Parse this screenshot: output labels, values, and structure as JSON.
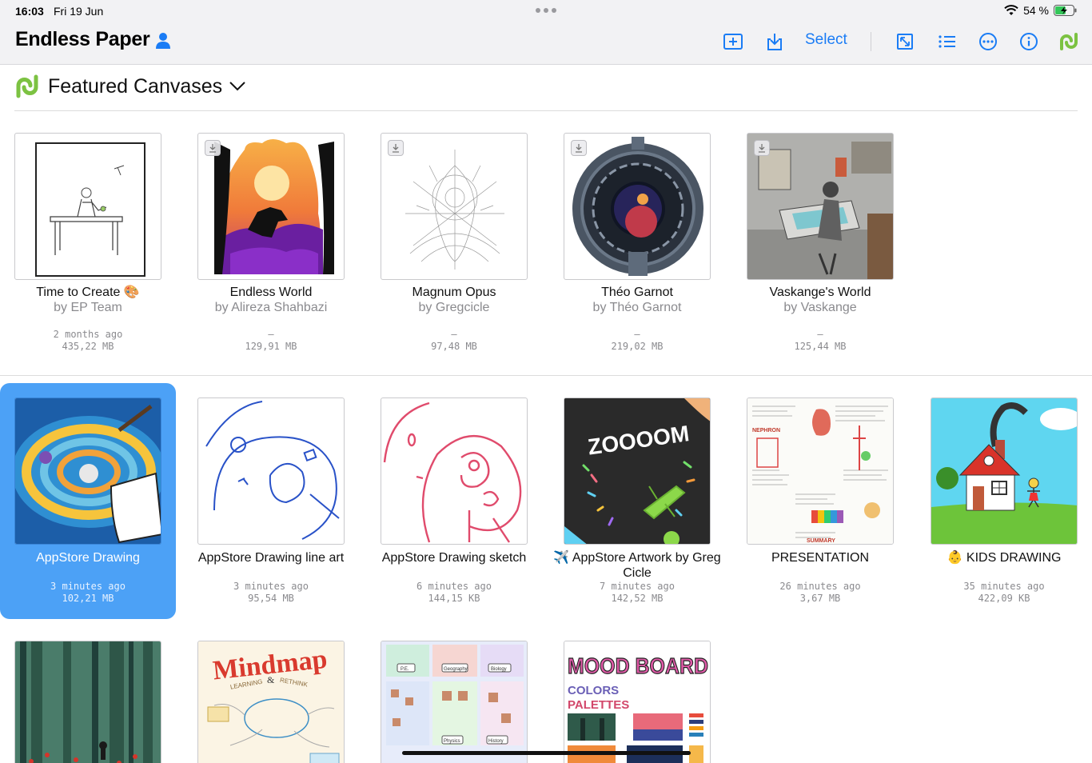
{
  "status_bar": {
    "time": "16:03",
    "date": "Fri 19 Jun",
    "battery": "54 %"
  },
  "nav": {
    "title": "Endless Paper",
    "select_label": "Select",
    "icons": [
      "add-canvas-icon",
      "import-icon",
      "fullscreen-icon",
      "list-icon",
      "more-icon",
      "info-icon",
      "link-icon"
    ]
  },
  "section": {
    "title": "Featured Canvases"
  },
  "featured": [
    {
      "title": "Time to Create 🎨",
      "author": "by EP Team",
      "modified": "2 months ago",
      "size": "435,22 MB"
    },
    {
      "title": "Endless World",
      "author": "by Alireza Shahbazi",
      "modified": "–",
      "size": "129,91 MB"
    },
    {
      "title": "Magnum Opus",
      "author": "by Gregcicle",
      "modified": "–",
      "size": "97,48 MB"
    },
    {
      "title": "Théo Garnot",
      "author": "by Théo Garnot",
      "modified": "–",
      "size": "219,02 MB"
    },
    {
      "title": "Vaskange's World",
      "author": "by Vaskange",
      "modified": "–",
      "size": "125,44 MB"
    }
  ],
  "canvases": [
    {
      "title": "AppStore Drawing",
      "modified": "3 minutes ago",
      "size": "102,21 MB"
    },
    {
      "title": "AppStore Drawing line art",
      "modified": "3 minutes ago",
      "size": "95,54 MB"
    },
    {
      "title": "AppStore Drawing sketch",
      "modified": "6 minutes ago",
      "size": "144,15 KB"
    },
    {
      "title": "✈️ AppStore Artwork by Greg Cicle",
      "modified": "7 minutes ago",
      "size": "142,52 MB"
    },
    {
      "title": "PRESENTATION",
      "modified": "26 minutes ago",
      "size": "3,67 MB"
    },
    {
      "title": "👶 KIDS DRAWING",
      "modified": "35 minutes ago",
      "size": "422,09 KB"
    }
  ],
  "thumb_text": {
    "mindmap": "Mindmap",
    "learning": "LEARNING",
    "amp": "&",
    "rethink": "RETHINK",
    "mood_board": "MOOD BOARD",
    "colors": "COLORS",
    "palettes": "PALETTES",
    "zoom": "ZOOOOM",
    "nephron": "NEPHRON",
    "summary": "SUMMARY",
    "pe": "P.E.",
    "geography": "Geography",
    "biology": "Biology",
    "physics": "Physics",
    "history": "History"
  },
  "colors": {
    "accent": "#1a7cf5",
    "selected": "#4ca1f6",
    "logo_green": "#7cc242"
  }
}
